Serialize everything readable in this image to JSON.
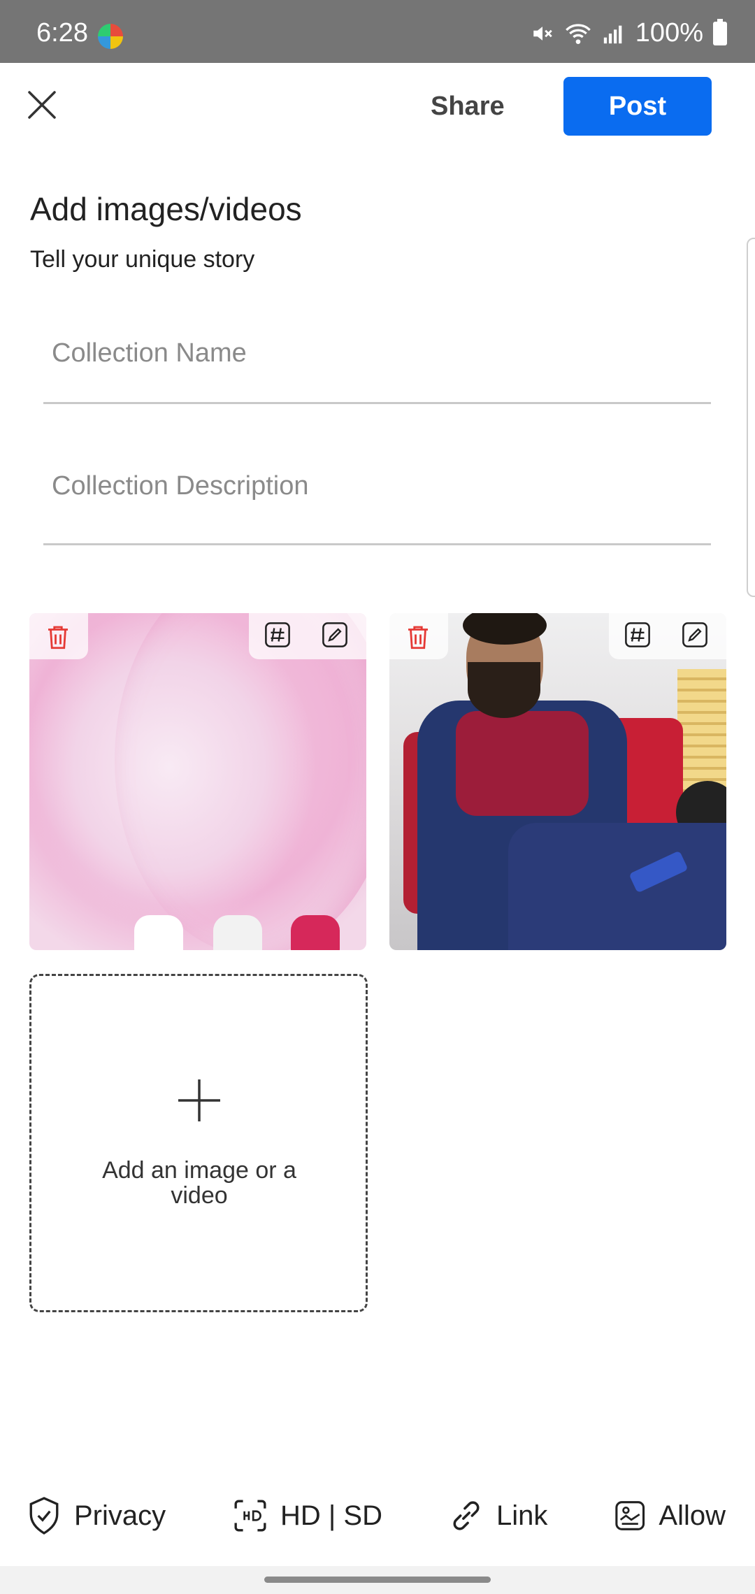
{
  "status_bar": {
    "time": "6:28",
    "battery": "100%"
  },
  "header": {
    "share_label": "Share",
    "post_label": "Post"
  },
  "content": {
    "title": "Add images/videos",
    "subtitle": "Tell your unique story",
    "collection_name_placeholder": "Collection Name",
    "collection_description_placeholder": "Collection Description",
    "add_media_label": "Add an image or a video"
  },
  "bottom_bar": {
    "items": [
      {
        "label": "Privacy",
        "icon": "shield-check-icon"
      },
      {
        "label": "HD | SD",
        "icon": "hd-focus-icon"
      },
      {
        "label": "Link",
        "icon": "link-icon"
      },
      {
        "label": "Allow",
        "icon": "image-settings-icon"
      }
    ]
  },
  "colors": {
    "accent": "#0a6cf0",
    "delete": "#e53935"
  }
}
